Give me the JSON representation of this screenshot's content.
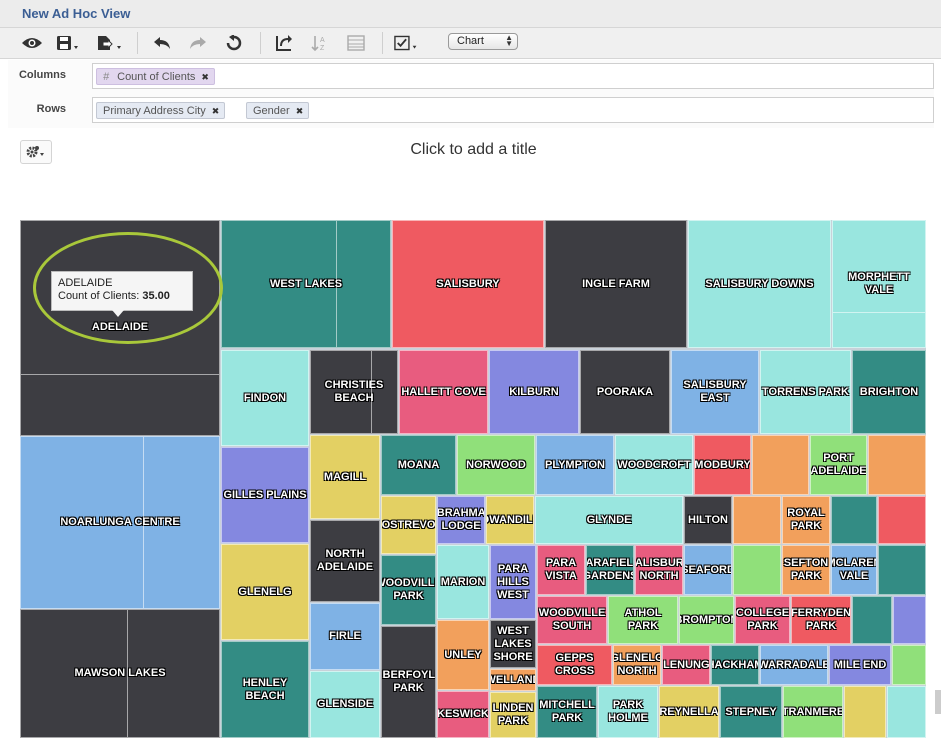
{
  "window": {
    "title": "New Ad Hoc View"
  },
  "toolbar": {
    "buttons": [
      "view-icon",
      "save-icon",
      "export-icon",
      "undo-icon",
      "redo-icon",
      "undo-all-icon",
      "switch-axes-icon",
      "sort-icon",
      "data-icon",
      "display-options-icon"
    ],
    "view_type": "Chart"
  },
  "columns": {
    "label": "Columns",
    "items": [
      {
        "name": "Count of Clients",
        "kind": "measure"
      }
    ]
  },
  "rows": {
    "label": "Rows",
    "items": [
      {
        "name": "Primary Address City"
      },
      {
        "name": "Gender"
      }
    ]
  },
  "chart": {
    "title_placeholder": "Click to add a title"
  },
  "tooltip": {
    "city": "ADELAIDE",
    "measure_label": "Count of Clients:",
    "measure_value": "35.00"
  },
  "chart_data": {
    "type": "treemap",
    "measure": "Count of Clients",
    "categories": [
      "ADELAIDE",
      "NOARLUNGA CENTRE",
      "MAWSON LAKES",
      "WEST LAKES",
      "SALISBURY",
      "INGLE FARM",
      "SALISBURY DOWNS",
      "MORPHETT VALE",
      "FINDON",
      "CHRISTIES BEACH",
      "HALLETT COVE",
      "KILBURN",
      "POORAKA",
      "SALISBURY EAST",
      "TORRENS PARK",
      "BRIGHTON",
      "GILLES PLAINS",
      "GLENELG",
      "HENLEY BEACH",
      "MAGILL",
      "NORTH ADELAIDE",
      "FIRLE",
      "GLENSIDE",
      "MOANA",
      "NORWOOD",
      "PLYMPTON",
      "WOODCROFT",
      "MODBURY",
      "PORT ADELAIDE",
      "ROSTREVOR",
      "BRAHMA LODGE",
      "COWANDILLA",
      "GLYNDE",
      "HILTON",
      "ROYAL PARK",
      "WOODVILLE PARK",
      "ABERFOYLE PARK",
      "MARION",
      "PARA HILLS WEST",
      "PARA VISTA",
      "PARAFIELD GARDENS",
      "SALISBURY NORTH",
      "SEAFORD",
      "SEFTON PARK",
      "MCLAREN VALE",
      "UNLEY",
      "WEST LAKES SHORE",
      "WOODVILLE SOUTH",
      "ATHOL PARK",
      "BROMPTON",
      "COLLEGE PARK",
      "FERRYDEN PARK",
      "GEPPS CROSS",
      "GLENELG NORTH",
      "GLENUNGA",
      "HACKHAM",
      "WARRADALE",
      "MILE END",
      "WELLAND",
      "KESWICK",
      "LINDEN PARK",
      "MITCHELL PARK",
      "PARK HOLME",
      "REYNELLA",
      "STEPNEY",
      "TRANMERE"
    ],
    "highlighted": {
      "category": "ADELAIDE",
      "value": 35
    }
  }
}
